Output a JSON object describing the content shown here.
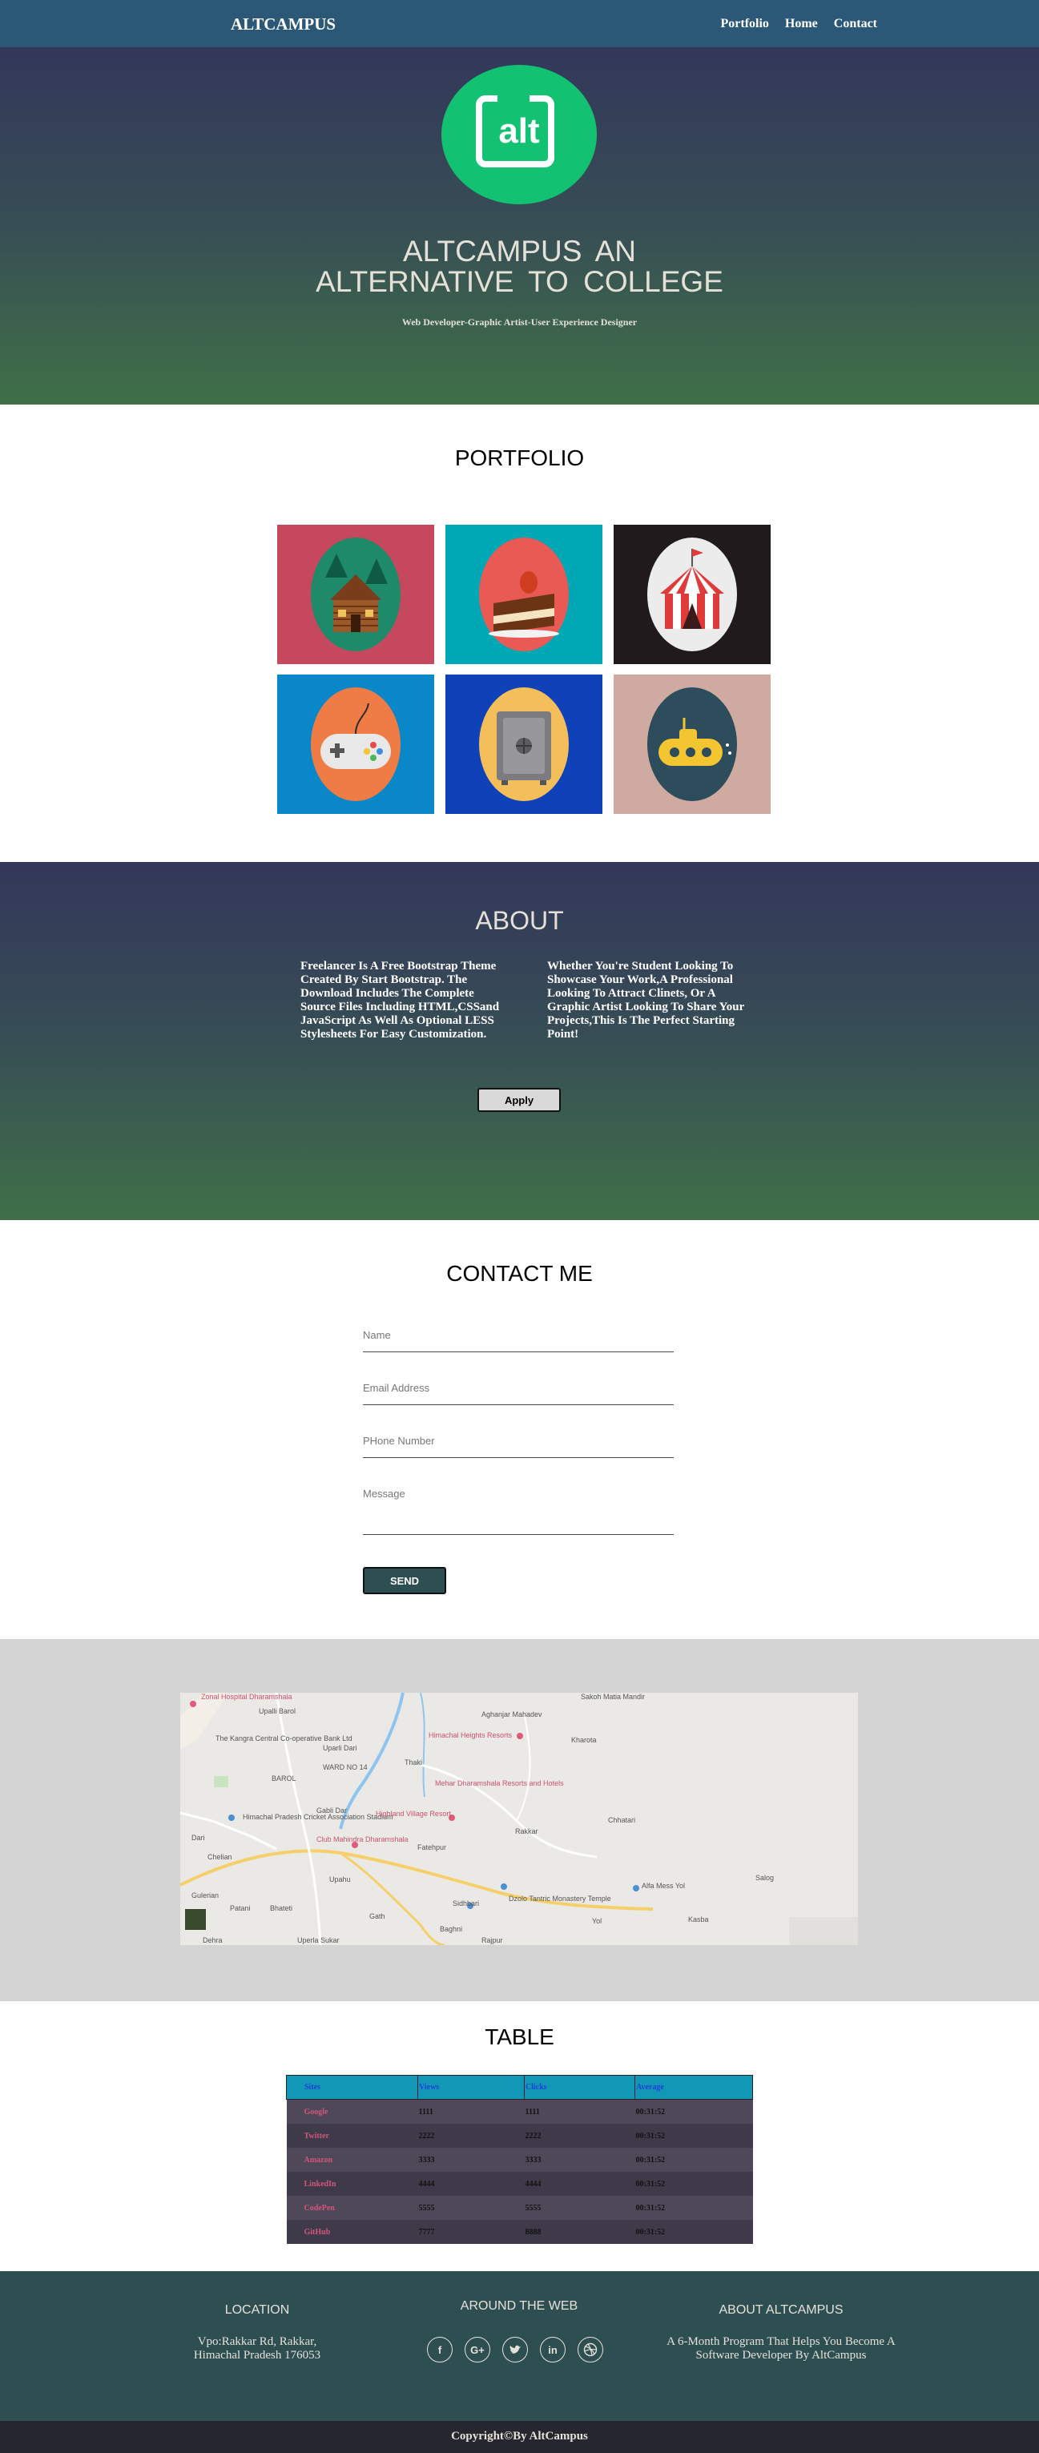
{
  "nav": {
    "brand": "ALTCAMPUS",
    "links": [
      "Portfolio",
      "Home",
      "Contact"
    ]
  },
  "hero": {
    "logo_text": "alt",
    "title_line1": "ALTCAMPUS AN",
    "title_line2": "ALTERNATIVE TO COLLEGE",
    "subtitle": "Web Developer-Graphic Artist-User Experience Designer"
  },
  "portfolio": {
    "title": "PORTFOLIO",
    "items": [
      {
        "icon": "cabin-icon",
        "bg": "#c5485f",
        "disc": "#1e8a6a"
      },
      {
        "icon": "cake-icon",
        "bg": "#00a7b5",
        "disc": "#ea5a55"
      },
      {
        "icon": "circus-tent-icon",
        "bg": "#211a1d",
        "disc": "#ececec"
      },
      {
        "icon": "game-controller-icon",
        "bg": "#0a87c8",
        "disc": "#ef7b45"
      },
      {
        "icon": "safe-icon",
        "bg": "#0f41b8",
        "disc": "#f4bf5b"
      },
      {
        "icon": "submarine-icon",
        "bg": "#cfaaa0",
        "disc": "#2d4c5c"
      }
    ]
  },
  "about": {
    "title": "ABOUT",
    "col1": "Freelancer Is A Free Bootstrap Theme Created By Start Bootstrap. The Download Includes The Complete Source Files Including HTML,CSSand JavaScript As Well As Optional LESS Stylesheets For Easy Customization.",
    "col2": "Whether You're Student Looking To Showcase Your Work,A Professional Looking To Attract Clinets, Or A Graphic Artist Looking To Share Your Projects,This Is The Perfect Starting Point!",
    "apply_label": "Apply"
  },
  "contact": {
    "title": "CONTACT ME",
    "name_placeholder": "Name",
    "email_placeholder": "Email Address",
    "phone_placeholder": "PHone Number",
    "message_placeholder": "Message",
    "send_label": "SEND"
  },
  "map": {
    "labels": [
      "Zonal Hospital Dharamshala",
      "Upalli Barol",
      "The Kangra Central Co-operative Bank Ltd",
      "Sakoh Matia Mandir",
      "Aghanjar Mahadev",
      "Himachal Heights Resorts",
      "Kharota",
      "Uparli Dari",
      "WARD NO 14",
      "Thaki",
      "BAROL",
      "Mehar Dharamshala Resorts and Hotels",
      "Gabli Dar",
      "Himachal Pradesh Cricket Association Stadium",
      "Highland Village Resort",
      "Chhatari",
      "Rakkar",
      "Chelian",
      "Club Mahindra Dharamshala",
      "Fatehpur",
      "Alfa Mess Yol",
      "Salog",
      "Dari",
      "Dzolo Tantric Monastery Temple",
      "Gulerian",
      "Patani",
      "Bhateti",
      "Sidhbari",
      "Kasba",
      "Gath",
      "Baghni",
      "Yol",
      "Dehra",
      "Uperla Sukar",
      "Rajpur",
      "Upahu"
    ]
  },
  "table": {
    "title": "TABLE",
    "headers": [
      "Sites",
      "Views",
      "Clicks",
      "Average"
    ],
    "rows": [
      [
        "Google",
        "1111",
        "1111",
        "00:31:52"
      ],
      [
        "Twitter",
        "2222",
        "2222",
        "00:31:52"
      ],
      [
        "Amazon",
        "3333",
        "3333",
        "00:31:52"
      ],
      [
        "LinkedIn",
        "4444",
        "4444",
        "00:31:52"
      ],
      [
        "CodePen",
        "5555",
        "5555",
        "00:31:52"
      ],
      [
        "GitHub",
        "7777",
        "8888",
        "00:31:52"
      ]
    ]
  },
  "footer": {
    "location_title": "LOCATION",
    "location_line1": "Vpo:Rakkar Rd, Rakkar,",
    "location_line2": "Himachal Pradesh 176053",
    "web_title": "AROUND THE WEB",
    "social": [
      "facebook-icon",
      "google-plus-icon",
      "twitter-icon",
      "linkedin-icon",
      "dribbble-icon"
    ],
    "about_title": "ABOUT ALTCAMPUS",
    "about_line1": "A 6-Month Program That Helps You Become A",
    "about_line2": "Software Developer By AltCampus",
    "copyright": "Copyright©By AltCampus"
  }
}
